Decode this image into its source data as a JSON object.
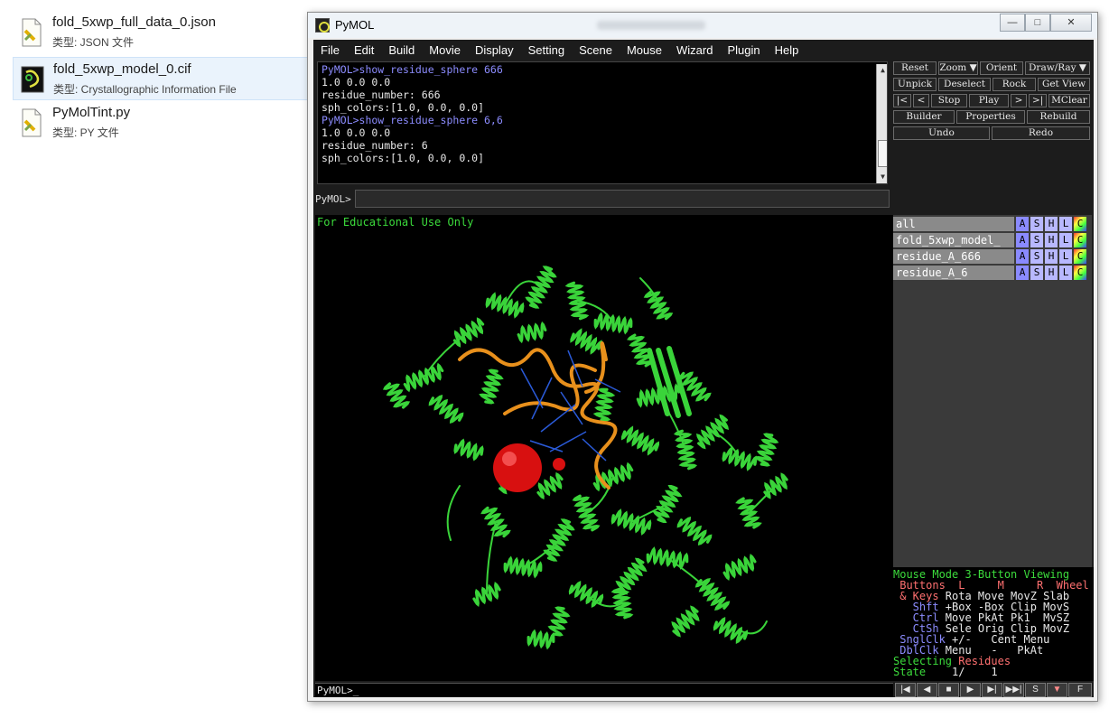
{
  "explorer": {
    "files": [
      {
        "name": "fold_5xwp_full_data_0.json",
        "type": "类型: JSON 文件",
        "icon": "json-file-icon"
      },
      {
        "name": "fold_5xwp_model_0.cif",
        "type": "类型: Crystallographic Information File",
        "icon": "cif-file-icon"
      },
      {
        "name": "PyMolTint.py",
        "type": "类型: PY 文件",
        "icon": "py-file-icon"
      }
    ]
  },
  "window": {
    "title": "PyMOL",
    "min_icon": "—",
    "max_icon": "□",
    "close_icon": "✕"
  },
  "menu": [
    "File",
    "Edit",
    "Build",
    "Movie",
    "Display",
    "Setting",
    "Scene",
    "Mouse",
    "Wizard",
    "Plugin",
    "Help"
  ],
  "console": {
    "lines": [
      {
        "text": "PyMOL>show_residue_sphere 666",
        "prompt": true
      },
      {
        "text": "1.0 0.0 0.0",
        "prompt": false
      },
      {
        "text": "residue_number: 666",
        "prompt": false
      },
      {
        "text": "sph_colors:[1.0, 0.0, 0.0]",
        "prompt": false
      },
      {
        "text": "PyMOL>show_residue_sphere 6,6",
        "prompt": true
      },
      {
        "text": "1.0 0.0 0.0",
        "prompt": false
      },
      {
        "text": "residue_number: 6",
        "prompt": false
      },
      {
        "text": "sph_colors:[1.0, 0.0, 0.0]",
        "prompt": false
      }
    ],
    "cmd_label": "PyMOL>",
    "cmd_value": ""
  },
  "controls": {
    "reset": "Reset",
    "zoom": "Zoom ▼",
    "orient": "Orient",
    "draw_ray": "Draw/Ray ▼",
    "unpick": "Unpick",
    "deselect": "Deselect",
    "rock": "Rock",
    "get_view": "Get View",
    "first": "|<",
    "prev": "<",
    "stop": "Stop",
    "play": "Play",
    "next": ">",
    "last": ">|",
    "mclear": "MClear",
    "builder": "Builder",
    "properties": "Properties",
    "rebuild": "Rebuild",
    "undo": "Undo",
    "redo": "Redo"
  },
  "viewer": {
    "watermark": "For Educational Use Only"
  },
  "objects": [
    {
      "name": "all"
    },
    {
      "name": "fold_5xwp_model_"
    },
    {
      "name": "residue_A_666"
    },
    {
      "name": "residue_A_6"
    }
  ],
  "obj_buttons": [
    "A",
    "S",
    "H",
    "L",
    "C"
  ],
  "mouse_info": {
    "line1": "Mouse Mode 3-Button Viewing",
    "line2": " Buttons  L     M     R  Wheel",
    "line3": [
      " & Keys",
      " Rota Move MovZ Slab"
    ],
    "line4": [
      "   Shft",
      " +Box -Box Clip MovS"
    ],
    "line5": [
      "   Ctrl",
      " Move PkAt Pk1  MvSZ"
    ],
    "line6": [
      "   CtSh",
      " Sele Orig Clip MovZ"
    ],
    "line7": [
      " SnglClk",
      " +/-   Cent Menu"
    ],
    "line8": [
      " DblClk",
      " Menu   -   PkAt"
    ],
    "line9": [
      "Selecting",
      " Residues"
    ],
    "line10": [
      "State",
      "    1/    1"
    ]
  },
  "bottom": {
    "prompt": "PyMOL>_"
  },
  "player": [
    "|◀",
    "◀",
    "■",
    "▶",
    "▶|",
    "▶▶|",
    "S",
    "▼",
    "F"
  ],
  "colors": {
    "prompt": "#8c8cff",
    "edu_green": "#3cdc3c",
    "protein_green": "#3ad43a",
    "rna_orange": "#e8901c",
    "sphere_red": "#e01010"
  }
}
